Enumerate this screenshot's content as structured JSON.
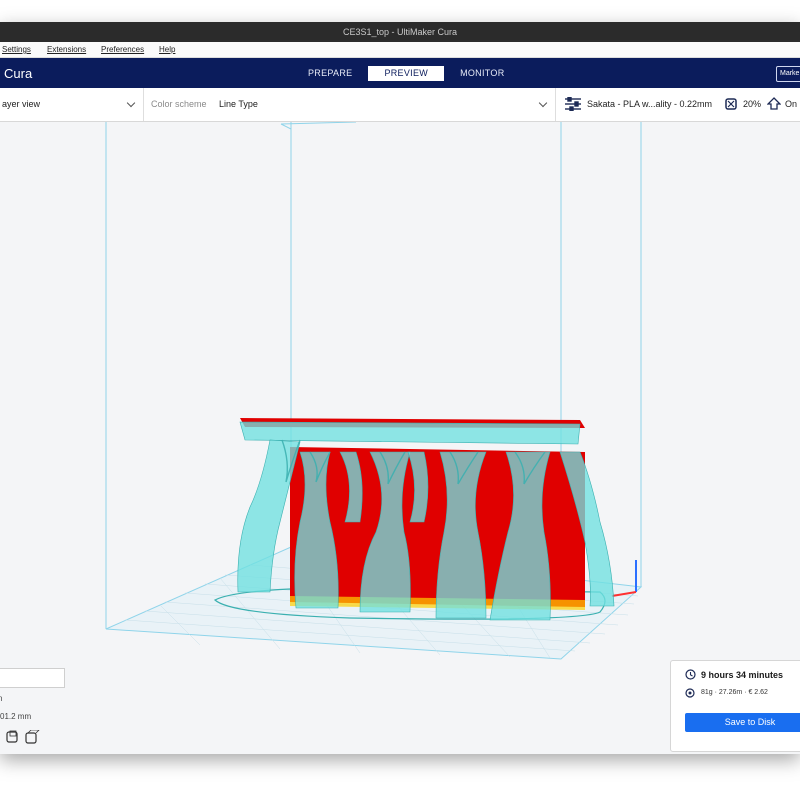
{
  "window": {
    "title": "CE3S1_top - UltiMaker Cura"
  },
  "menu": {
    "items": [
      "Settings",
      "Extensions",
      "Preferences",
      "Help"
    ]
  },
  "header": {
    "brand": "Cura",
    "stages": [
      {
        "label": "PREPARE",
        "active": false
      },
      {
        "label": "PREVIEW",
        "active": true
      },
      {
        "label": "MONITOR",
        "active": false
      }
    ],
    "marketplace_label": "Marke"
  },
  "toolbar": {
    "view_type": "ayer view",
    "color_scheme_label": "Color scheme",
    "color_scheme_value": "Line Type",
    "profile": "Sakata - PLA w...ality - 0.22mm",
    "infill": "20%",
    "support": "On"
  },
  "bottom_left": {
    "line1": "n",
    "line2": "01.2 mm"
  },
  "print_info": {
    "time": "9 hours 34 minutes",
    "details": "81g · 27.26m · € 2.62",
    "save_label": "Save to Disk"
  },
  "colors": {
    "accent": "#196ef0",
    "header": "#0b1c5c",
    "support": "#6fe0e0",
    "model": "#e00000"
  },
  "icons": [
    "settings-sliders-icon",
    "infill-icon",
    "support-icon",
    "clock-icon",
    "material-icon",
    "play-icon",
    "chevron-down-icon"
  ]
}
